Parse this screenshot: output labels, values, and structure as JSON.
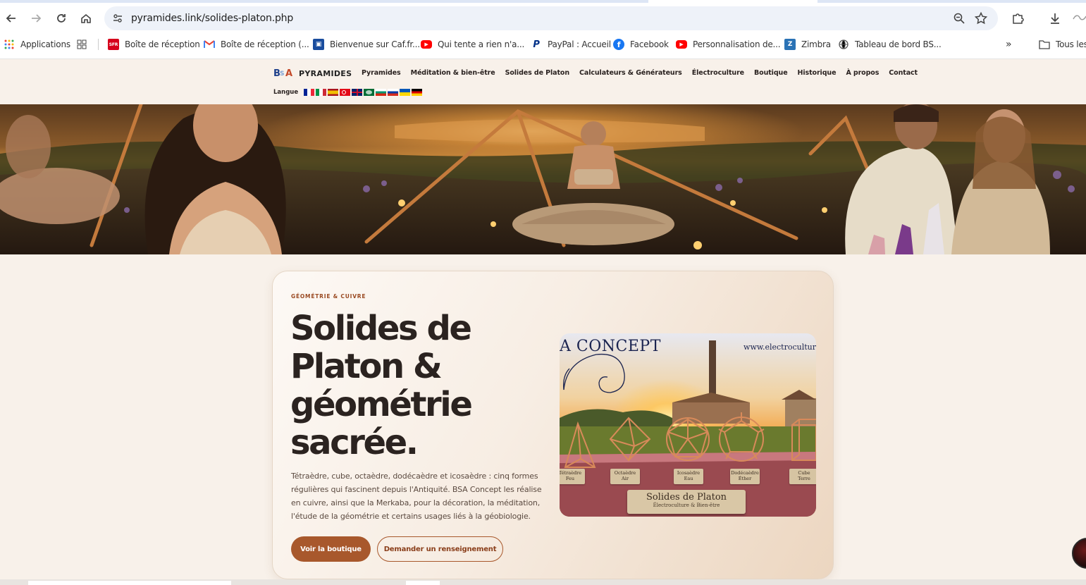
{
  "browser": {
    "url": "pyramides.link/solides-platon.php",
    "bookmarks": [
      {
        "label": "Applications",
        "icon": "apps-grid-icon"
      },
      {
        "label": "",
        "icon": "grid-icon"
      },
      {
        "label": "Boîte de réception",
        "icon": "sfr-icon"
      },
      {
        "label": "Boîte de réception (...",
        "icon": "gmail-icon"
      },
      {
        "label": "Bienvenue sur Caf.fr...",
        "icon": "caf-icon"
      },
      {
        "label": "Qui tente a rien n'a...",
        "icon": "youtube-icon"
      },
      {
        "label": "PayPal : Accueil",
        "icon": "paypal-icon"
      },
      {
        "label": "Facebook",
        "icon": "facebook-icon"
      },
      {
        "label": "Personnalisation de...",
        "icon": "youtube-icon"
      },
      {
        "label": "Zimbra",
        "icon": "zimbra-icon"
      },
      {
        "label": "Tableau de bord BS...",
        "icon": "globe-icon"
      }
    ],
    "all_bookmarks": "Tous les"
  },
  "site": {
    "logo_text": "PYRAMIDES",
    "logo_mark": {
      "b": "B",
      "s": "S",
      "a": "A"
    },
    "nav": [
      "Pyramides",
      "Méditation & bien-être",
      "Solides de Platon",
      "Calculateurs & Générateurs",
      "Électroculture",
      "Boutique",
      "Historique",
      "À propos",
      "Contact"
    ],
    "language_label": "Langue",
    "flags": [
      "fr",
      "it",
      "es",
      "tr",
      "gb",
      "ar",
      "bg",
      "ru",
      "ua",
      "de"
    ]
  },
  "hero_card": {
    "eyebrow": "GÉOMÉTRIE & CUIVRE",
    "title": "Solides de Platon & géométrie sacrée.",
    "description": "Tétraèdre, cube, octaèdre, dodécaèdre et icosaèdre : cinq formes régulières qui fascinent depuis l'Antiquité. BSA Concept les réalise en cuivre, ainsi que la Merkaba, pour la décoration, la méditation, l'étude de la géométrie et certains usages liés à la géobiologie.",
    "primary_button": "Voir la boutique",
    "secondary_button": "Demander un renseignement",
    "photo": {
      "brand": "A CONCEPT",
      "website": "www.electrocultur",
      "plaque_title": "Solides de Platon",
      "plaque_subtitle": "Électroculture & Bien-être",
      "labels": [
        {
          "name": "Tétraèdre",
          "sub": "Feu"
        },
        {
          "name": "Octaèdre",
          "sub": "Air"
        },
        {
          "name": "Icosaèdre",
          "sub": "Eau"
        },
        {
          "name": "Dodécaèdre",
          "sub": "Éther"
        },
        {
          "name": "Cube",
          "sub": "Terre"
        }
      ]
    }
  },
  "colors": {
    "accent": "#a8582c",
    "page_bg": "#f8f1ea",
    "title": "#2b2320"
  }
}
